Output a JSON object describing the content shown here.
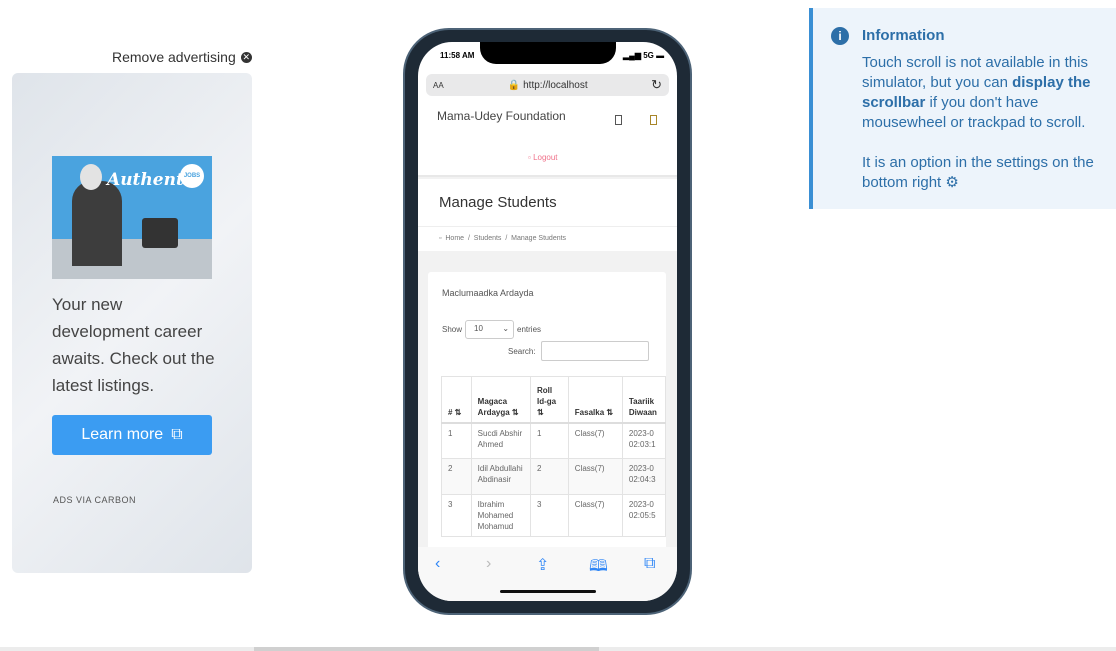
{
  "ad": {
    "remove": "Remove advertising",
    "image_text": "Authentic",
    "image_badge": "JOBS",
    "text": "Your new development career awaits. Check out the latest listings.",
    "button": "Learn more",
    "via": "ADS VIA CARBON"
  },
  "phone": {
    "time": "11:58 AM",
    "signal": "5G",
    "text_size": "AA",
    "url": "http://localhost",
    "brand": "Mama-Udey Foundation",
    "logout": "Logout",
    "page_title": "Manage Students",
    "breadcrumb": [
      "Home",
      "Students",
      "Manage Students"
    ],
    "card_title": "Maclumaadka Ardayda",
    "show": "Show",
    "entries_value": "10",
    "entries": "entries",
    "search": "Search:",
    "columns": [
      "#",
      "Magaca Ardayga",
      "Roll Id-ga",
      "Fasalka",
      "Taariik Diwaan"
    ],
    "rows": [
      [
        "1",
        "Sucdi Abshir Ahmed",
        "1",
        "Class(7)",
        "2023-0 02:03:1"
      ],
      [
        "2",
        "Idil Abdullahi Abdinasir",
        "2",
        "Class(7)",
        "2023-0 02:04:3"
      ],
      [
        "3",
        "Ibrahim Mohamed Mohamud",
        "3",
        "Class(7)",
        "2023-0 02:05:5"
      ]
    ]
  },
  "info": {
    "title": "Information",
    "p1_a": "Touch scroll is not available in this simulator, but you can ",
    "p1_b": "display the scrollbar",
    "p1_c": " if you don't have mousewheel or trackpad to scroll.",
    "p2": "It is an option in the settings on the bottom right"
  }
}
